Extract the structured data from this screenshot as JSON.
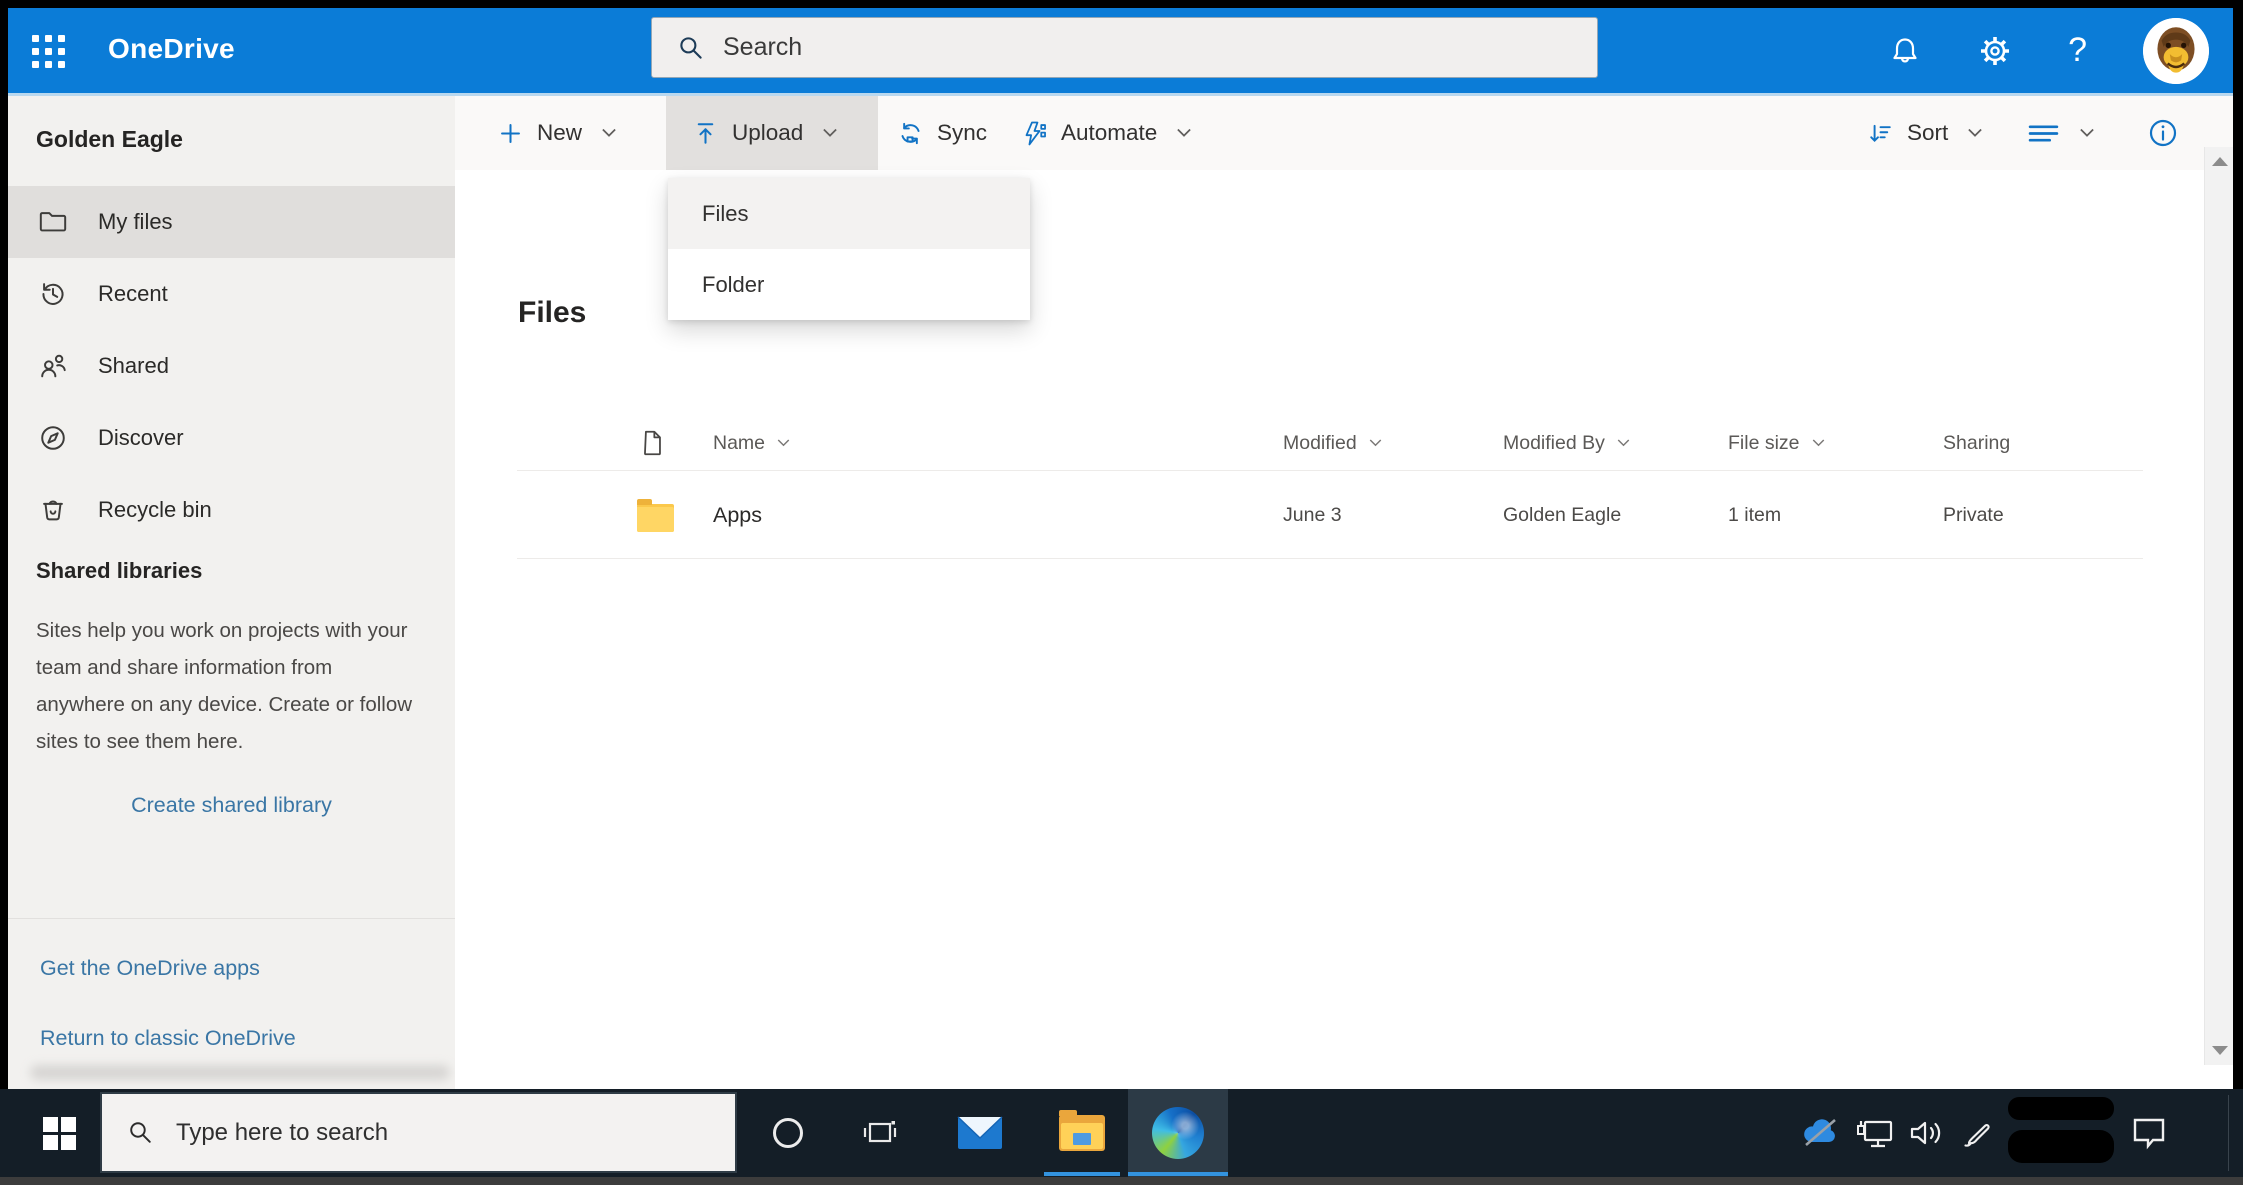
{
  "header": {
    "app_title": "OneDrive",
    "search_placeholder": "Search",
    "help_label": "?",
    "accent_color": "#0b7cd7"
  },
  "sidebar": {
    "title": "Golden Eagle",
    "items": [
      {
        "label": "My files",
        "icon": "folder-icon",
        "selected": true
      },
      {
        "label": "Recent",
        "icon": "history-icon",
        "selected": false
      },
      {
        "label": "Shared",
        "icon": "people-icon",
        "selected": false
      },
      {
        "label": "Discover",
        "icon": "compass-icon",
        "selected": false
      },
      {
        "label": "Recycle bin",
        "icon": "recycle-bin-icon",
        "selected": false
      }
    ],
    "section_title": "Shared libraries",
    "section_text": "Sites help you work on projects with your team and share information from anywhere on any device. Create or follow sites to see them here.",
    "create_link": "Create shared library",
    "links": [
      "Get the OneDrive apps",
      "Return to classic OneDrive"
    ],
    "link_color": "#3a76a5"
  },
  "toolbar": {
    "new_label": "New",
    "upload_label": "Upload",
    "sync_label": "Sync",
    "automate_label": "Automate",
    "sort_label": "Sort"
  },
  "upload_menu": {
    "items": [
      "Files",
      "Folder"
    ]
  },
  "main": {
    "title": "Files",
    "table": {
      "columns": [
        "Name",
        "Modified",
        "Modified By",
        "File size",
        "Sharing"
      ],
      "rows": [
        {
          "name": "Apps",
          "icon": "folder",
          "modified": "June 3",
          "modified_by": "Golden Eagle",
          "file_size": "1 item",
          "sharing": "Private"
        }
      ]
    }
  },
  "taskbar": {
    "search_placeholder": "Type here to search",
    "pinned": [
      "start",
      "cortana",
      "task-view",
      "mail",
      "file-explorer",
      "edge"
    ],
    "active_app": "edge",
    "tray": [
      "onedrive-cloud",
      "network",
      "volume",
      "pen",
      "action-center"
    ],
    "underline_color": "#3393df"
  },
  "colors": {
    "header_blue": "#0b7cd7",
    "sidebar_gray": "#f2f1ef",
    "selected_gray": "#e0dedc",
    "taskbar_dark": "#141e27",
    "folder_yellow": "#fbc84b"
  }
}
